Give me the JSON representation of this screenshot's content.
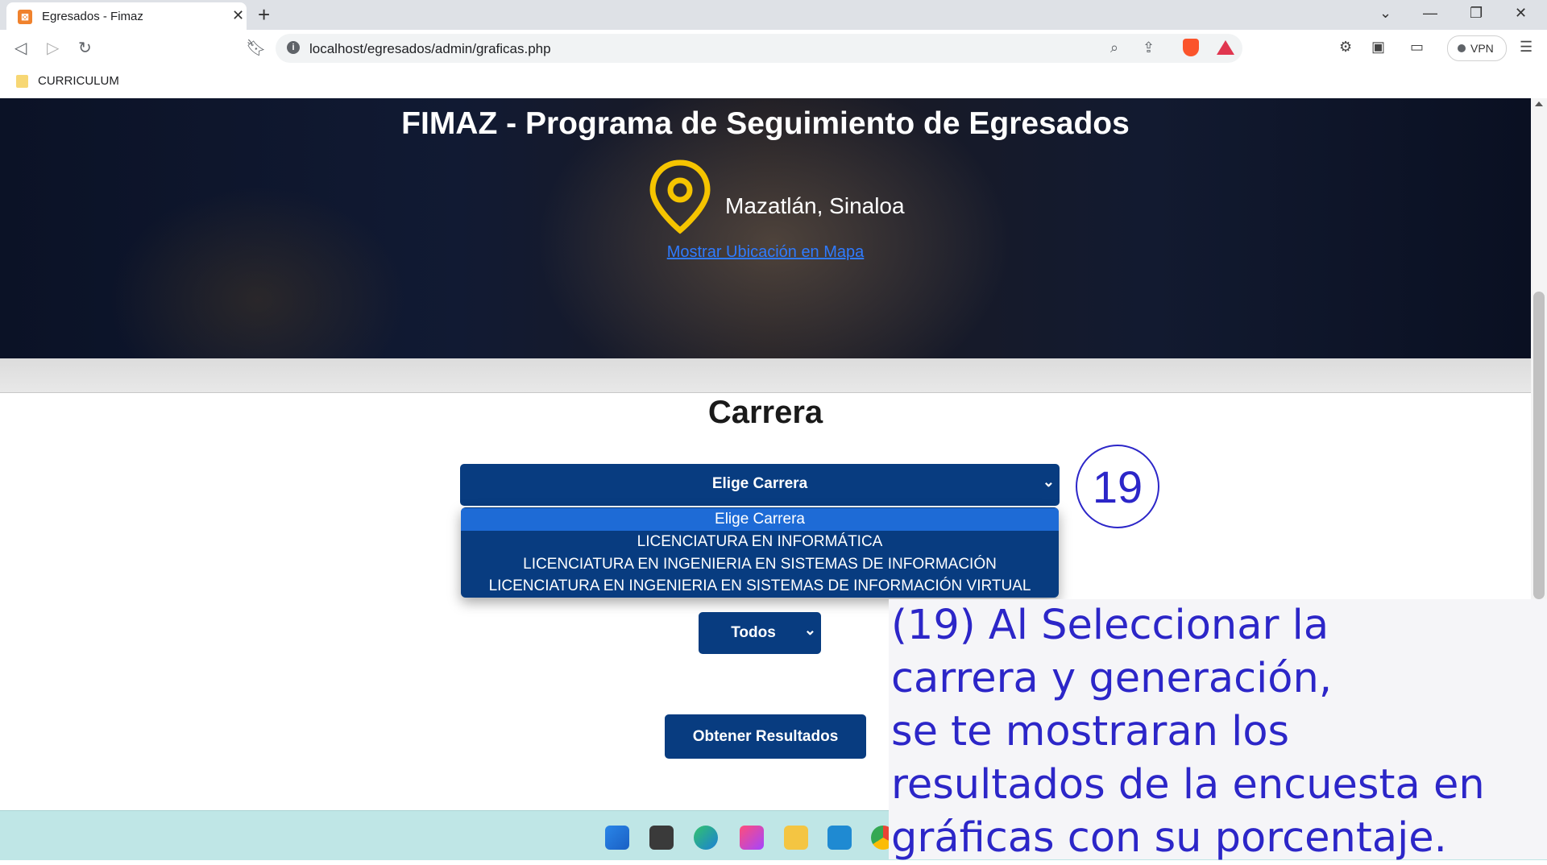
{
  "browser": {
    "tab_title": "Egresados - Fimaz",
    "tab_favicon": "xampp-icon",
    "url": "localhost/egresados/admin/graficas.php",
    "vpn_label": "VPN",
    "bookmark": "CURRICULUM"
  },
  "hero": {
    "title": "FIMAZ - Programa de Seguimiento de Egresados",
    "city": "Mazatlán, Sinaloa",
    "map_link": "Mostrar Ubicación en Mapa",
    "pin_color": "#f5c400"
  },
  "form": {
    "section_title": "Carrera",
    "carrera_select": "Elige Carrera",
    "carrera_options": [
      "Elige Carrera",
      "LICENCIATURA EN INFORMÁTICA",
      "LICENCIATURA EN INGENIERIA EN SISTEMAS DE INFORMACIÓN",
      "LICENCIATURA EN INGENIERIA EN SISTEMAS DE INFORMACIÓN VIRTUAL"
    ],
    "generacion_select": "Todos",
    "submit_button": "Obtener Resultados",
    "primary_color": "#083c80",
    "highlight_color": "#1e6bd6"
  },
  "annotation": {
    "step": "19",
    "lines": [
      "(19) Al Seleccionar la",
      "carrera y generación,",
      "se te mostraran los",
      "resultados de la encuesta en",
      "gráficas con su porcentaje."
    ],
    "color": "#2c26c8"
  }
}
